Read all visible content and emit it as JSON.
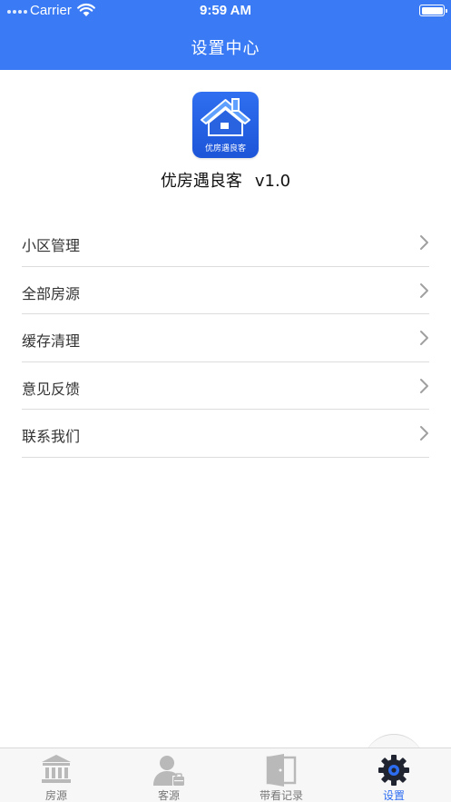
{
  "status_bar": {
    "carrier": "Carrier",
    "time": "9:59 AM"
  },
  "header": {
    "title": "设置中心"
  },
  "app": {
    "logo_text": "优房遇良客",
    "name": "优房遇良客",
    "version": "v1.0"
  },
  "menu": [
    {
      "label": "小区管理"
    },
    {
      "label": "全部房源"
    },
    {
      "label": "缓存清理"
    },
    {
      "label": "意见反馈"
    },
    {
      "label": "联系我们"
    }
  ],
  "tabs": [
    {
      "label": "房源",
      "icon": "building-icon",
      "active": false
    },
    {
      "label": "客源",
      "icon": "user-icon",
      "active": false
    },
    {
      "label": "带看记录",
      "icon": "door-icon",
      "active": false
    },
    {
      "label": "设置",
      "icon": "gear-icon",
      "active": true
    }
  ],
  "colors": {
    "primary": "#3a7bf5",
    "active_tab": "#2d6df2",
    "inactive_tab": "#777777"
  }
}
